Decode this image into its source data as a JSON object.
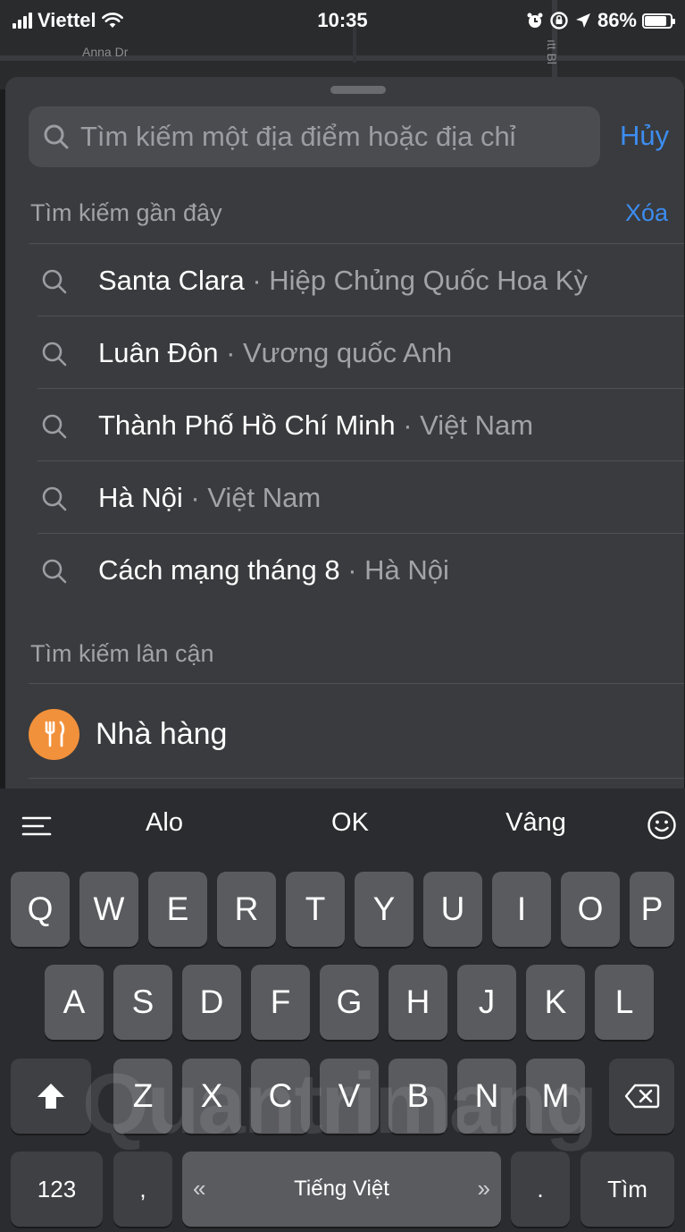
{
  "map": {
    "street_label": "Anna Dr",
    "street_label_vertical": "ıtt Bl"
  },
  "status_bar": {
    "carrier": "Viettel",
    "time": "10:35",
    "battery": "86%",
    "battery_level": 0.86
  },
  "search": {
    "placeholder": "Tìm kiếm một địa điểm hoặc địa chỉ",
    "cancel_label": "Hủy"
  },
  "recent": {
    "header": "Tìm kiếm gần đây",
    "clear_label": "Xóa",
    "items": [
      {
        "primary": "Santa Clara",
        "secondary": " · Hiệp Chủng Quốc Hoa Kỳ"
      },
      {
        "primary": "Luân Đôn",
        "secondary": " · Vương quốc Anh"
      },
      {
        "primary": "Thành Phố Hồ Chí Minh",
        "secondary": " · Việt Nam"
      },
      {
        "primary": "Hà Nội",
        "secondary": " · Việt Nam"
      },
      {
        "primary": "Cách mạng tháng 8",
        "secondary": " · Hà Nội"
      }
    ]
  },
  "nearby": {
    "header": "Tìm kiếm lân cận",
    "items": [
      {
        "label": "Nhà hàng",
        "icon": "fork-knife-icon",
        "color": "#f2913b"
      }
    ]
  },
  "keyboard": {
    "predictions": [
      "Alo",
      "OK",
      "Vâng"
    ],
    "row1": [
      "Q",
      "W",
      "E",
      "R",
      "T",
      "Y",
      "U",
      "I",
      "O",
      "P"
    ],
    "row2": [
      "A",
      "S",
      "D",
      "F",
      "G",
      "H",
      "J",
      "K",
      "L"
    ],
    "row3": [
      "Z",
      "X",
      "C",
      "V",
      "B",
      "N",
      "M"
    ],
    "numbers_label": "123",
    "comma_label": ",",
    "space_label": "Tiếng Việt",
    "space_left_arrow": "«",
    "space_right_arrow": "»",
    "period_label": ".",
    "return_label": "Tìm"
  },
  "watermark": "Quantrimang",
  "colors": {
    "accent": "#3c8df0",
    "sheet": "#3a3b3e",
    "key": "#5a5b5f",
    "key_dark": "#3f4044"
  }
}
